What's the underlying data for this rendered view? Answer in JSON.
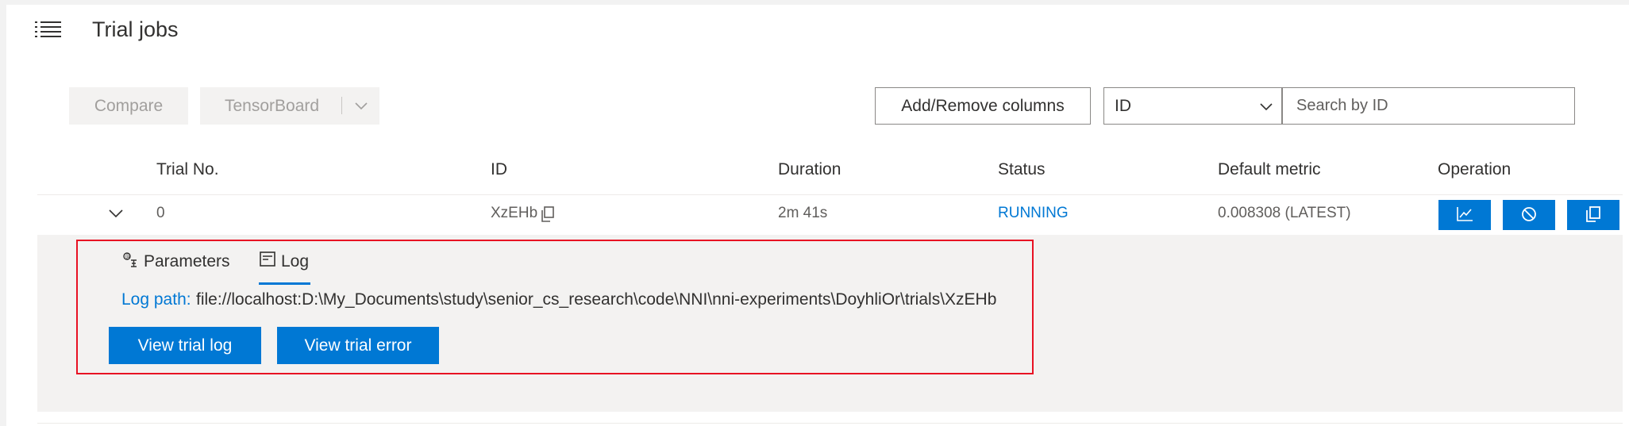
{
  "header": {
    "title": "Trial jobs",
    "icon": "list-icon"
  },
  "toolbar": {
    "compare_label": "Compare",
    "tensorboard_label": "TensorBoard",
    "columns_label": "Add/Remove columns",
    "search_field_value": "ID",
    "search_placeholder": "Search by ID"
  },
  "table": {
    "columns": [
      "Trial No.",
      "ID",
      "Duration",
      "Status",
      "Default metric",
      "Operation"
    ],
    "rows": [
      {
        "trial_no": "0",
        "id": "XzEHb",
        "duration": "2m 41s",
        "status": "RUNNING",
        "default_metric": "0.008308 (LATEST)",
        "operations": [
          "chart-line-icon",
          "cancel-icon",
          "copy-icon"
        ]
      }
    ]
  },
  "detail": {
    "tabs": [
      {
        "label": "Parameters",
        "icon": "parameters-icon"
      },
      {
        "label": "Log",
        "icon": "log-icon",
        "selected": true
      }
    ],
    "log_path_label": "Log path:",
    "log_path_value": "file://localhost:D:\\My_Documents\\study\\senior_cs_research\\code\\NNI\\nni-experiments\\DoyhliOr\\trials\\XzEHb",
    "view_log_label": "View trial log",
    "view_error_label": "View trial error"
  },
  "colors": {
    "accent": "#0078d4",
    "highlight_border": "#e81123",
    "detail_background": "#f3f2f1"
  }
}
